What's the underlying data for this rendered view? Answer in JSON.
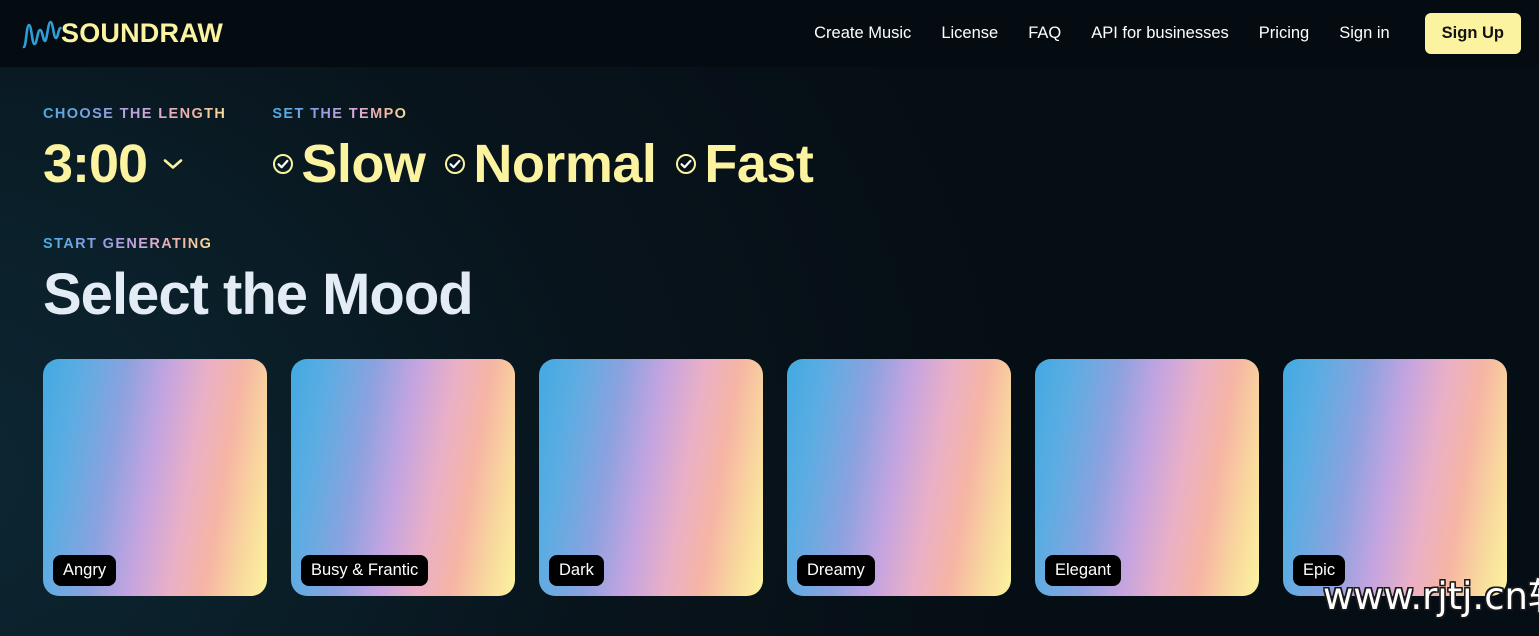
{
  "header": {
    "logo": {
      "text": "SOUNDRAW",
      "wave_icon": "waveform-icon",
      "wave_color": "#2e9fd6",
      "text_color": "#fbf3a0"
    },
    "nav": [
      {
        "label": "Create Music"
      },
      {
        "label": "License"
      },
      {
        "label": "FAQ"
      },
      {
        "label": "API for businesses"
      },
      {
        "label": "Pricing"
      },
      {
        "label": "Sign in"
      }
    ],
    "signup": {
      "label": "Sign Up",
      "bg": "#fbf3a0",
      "fg": "#121212"
    }
  },
  "length": {
    "eyebrow": "CHOOSE THE LENGTH",
    "value": "3:00",
    "chevron_icon": "chevron-down-icon"
  },
  "tempo": {
    "eyebrow": "SET THE TEMPO",
    "options": [
      {
        "label": "Slow",
        "icon": "check-circle-icon",
        "selected": true
      },
      {
        "label": "Normal",
        "icon": "check-circle-icon",
        "selected": true
      },
      {
        "label": "Fast",
        "icon": "check-circle-icon",
        "selected": true
      }
    ]
  },
  "mood": {
    "eyebrow": "START GENERATING",
    "title": "Select the Mood",
    "cards": [
      {
        "label": "Angry"
      },
      {
        "label": "Busy & Frantic"
      },
      {
        "label": "Dark"
      },
      {
        "label": "Dreamy"
      },
      {
        "label": "Elegant"
      },
      {
        "label": "Epic"
      }
    ]
  },
  "watermark": {
    "text": "www.rjtj.cn软荐网"
  },
  "colors": {
    "accent_yellow": "#fbf3a0",
    "header_bg": "#040b11",
    "page_bg": "#0a1e28",
    "heading": "#e3ecf5",
    "card_gradient_start": "#43a9e3",
    "card_gradient_end": "#fbf3a0"
  }
}
